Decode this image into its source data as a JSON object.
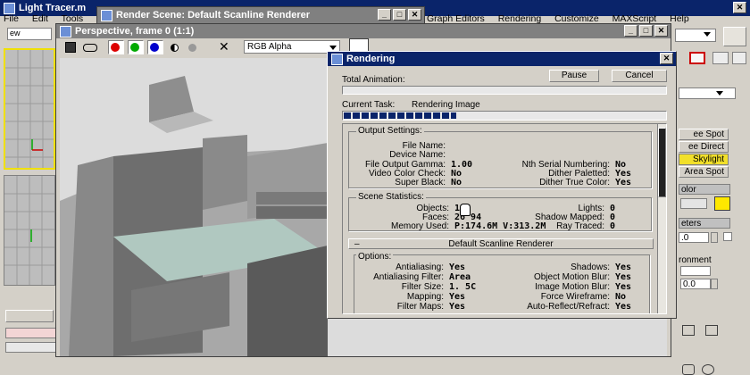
{
  "main": {
    "title": "Light Tracer.m",
    "menu_left": [
      "File",
      "Edit",
      "Tools"
    ],
    "menu_right": [
      "Graph Editors",
      "Rendering",
      "Customize",
      "MAXScript",
      "Help"
    ],
    "toolbar_field": "ew"
  },
  "render_scene": {
    "title": "Render Scene: Default Scanline Renderer"
  },
  "frame_window": {
    "title": "Perspective, frame 0 (1:1)",
    "channel": "RGB Alpha"
  },
  "rendering": {
    "title": "Rendering",
    "total_animation_label": "Total Animation:",
    "pause_label": "Pause",
    "cancel_label": "Cancel",
    "current_task_label": "Current Task:",
    "current_task_value": "Rendering Image",
    "task_progress": 0.35,
    "output_settings": {
      "title": "Output Settings:",
      "file_name_label": "File Name:",
      "device_name_label": "Device Name:",
      "gamma_label": "File Output Gamma:",
      "gamma_value": "1.00",
      "video_check_label": "Video Color Check:",
      "video_check_value": "No",
      "super_black_label": "Super Black:",
      "super_black_value": "No",
      "nth_serial_label": "Nth Serial Numbering:",
      "nth_serial_value": "No",
      "dither_paletted_label": "Dither Paletted:",
      "dither_paletted_value": "Yes",
      "dither_true_label": "Dither True Color:",
      "dither_true_value": "Yes"
    },
    "scene_stats": {
      "title": "Scene Statistics:",
      "objects_label": "Objects:",
      "objects_value": "157",
      "faces_label": "Faces:",
      "faces_value": "26 94",
      "memory_label": "Memory Used:",
      "memory_value": "P:174.6M V:313.2M",
      "lights_label": "Lights:",
      "lights_value": "0",
      "shadow_mapped_label": "Shadow Mapped:",
      "shadow_mapped_value": "0",
      "ray_traced_label": "Ray Traced:",
      "ray_traced_value": "0"
    },
    "rollout_title": "Default Scanline Renderer",
    "rollout_toggle": "–",
    "options": {
      "title": "Options:",
      "antialiasing_label": "Antialiasing:",
      "antialiasing_value": "Yes",
      "aa_filter_label": "Antialiasing Filter:",
      "aa_filter_value": "Area",
      "filter_size_label": "Filter Size:",
      "filter_size_value": "1. 5C",
      "mapping_label": "Mapping:",
      "mapping_value": "Yes",
      "filter_maps_label": "Filter Maps:",
      "filter_maps_value": "Yes",
      "shadows_label": "Shadows:",
      "shadows_value": "Yes",
      "omb_label": "Object Motion Blur:",
      "omb_value": "Yes",
      "imb_label": "Image Motion Blur:",
      "imb_value": "Yes",
      "force_wire_label": "Force Wireframe:",
      "force_wire_value": "No",
      "auto_reflect_label": "Auto-Reflect/Refract:",
      "auto_reflect_value": "Yes"
    }
  },
  "right_panel": {
    "buttons": [
      "ee Spot",
      "ee Direct",
      "Skylight",
      "Area Spot"
    ],
    "section_olor": "olor",
    "section_eters": "eters",
    "spinner_value": ".0",
    "section_ronment": "ronment",
    "spinner2_value": "0.0",
    "highlight_color": "#f2e02a",
    "swatch_color": "#ffe800"
  }
}
